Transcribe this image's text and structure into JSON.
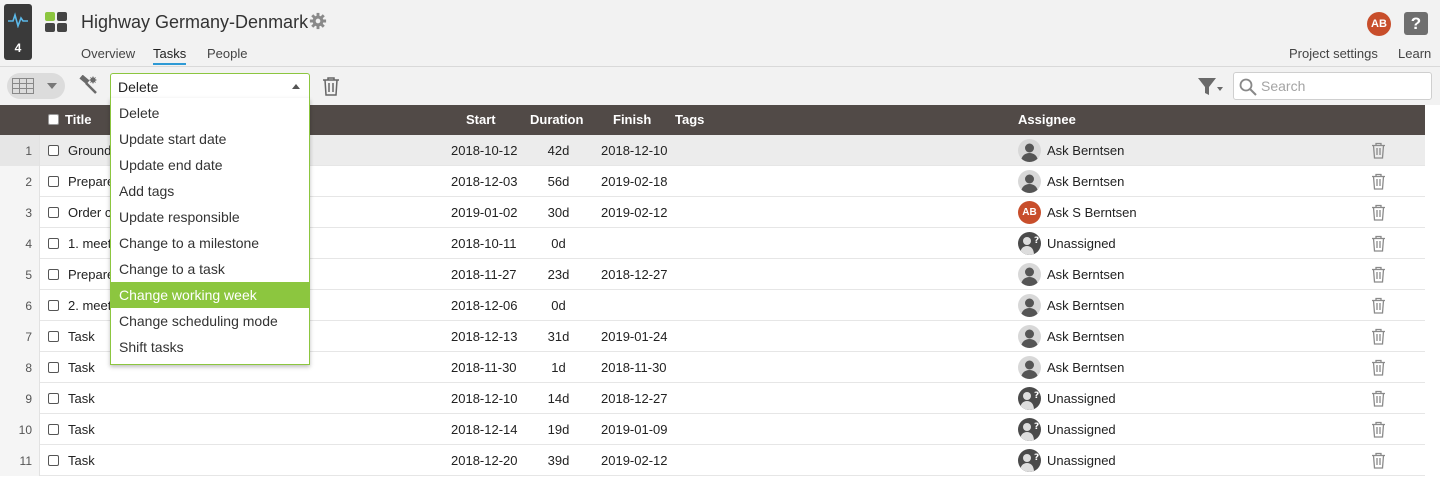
{
  "activity": {
    "count": "4"
  },
  "project": {
    "title": "Highway Germany-Denmark"
  },
  "nav": {
    "tabs": [
      "Overview",
      "Tasks",
      "People"
    ],
    "active": "Tasks"
  },
  "header_right": {
    "settings_link": "Project settings",
    "learn_link": "Learn",
    "user_initials": "AB",
    "help": "?"
  },
  "toolbar": {
    "bulk_action": {
      "selected": "Delete"
    },
    "search": {
      "placeholder": "Search",
      "value": ""
    }
  },
  "bulk_action_options": [
    "Delete",
    "Update start date",
    "Update end date",
    "Add tags",
    "Update responsible",
    "Change to a milestone",
    "Change to a task",
    "Change working week",
    "Change scheduling mode",
    "Shift tasks"
  ],
  "bulk_action_highlighted": "Change working week",
  "columns": {
    "title": "Title",
    "start": "Start",
    "duration": "Duration",
    "finish": "Finish",
    "tags": "Tags",
    "assignee": "Assignee"
  },
  "rows": [
    {
      "num": "1",
      "title": "Ground",
      "start": "2018-10-12",
      "duration": "42d",
      "finish": "2018-12-10",
      "assignee": "Ask Berntsen",
      "avatar": "person"
    },
    {
      "num": "2",
      "title": "Prepare",
      "start": "2018-12-03",
      "duration": "56d",
      "finish": "2019-02-18",
      "assignee": "Ask Berntsen",
      "avatar": "person"
    },
    {
      "num": "3",
      "title": "Order c",
      "start": "2019-01-02",
      "duration": "30d",
      "finish": "2019-02-12",
      "assignee": "Ask S Berntsen",
      "avatar": "AB"
    },
    {
      "num": "4",
      "title": "1. meet",
      "start": "2018-10-11",
      "duration": "0d",
      "finish": "",
      "assignee": "Unassigned",
      "avatar": "unassigned"
    },
    {
      "num": "5",
      "title": "Prepare",
      "start": "2018-11-27",
      "duration": "23d",
      "finish": "2018-12-27",
      "assignee": "Ask Berntsen",
      "avatar": "person"
    },
    {
      "num": "6",
      "title": "2. meet",
      "start": "2018-12-06",
      "duration": "0d",
      "finish": "",
      "assignee": "Ask Berntsen",
      "avatar": "person"
    },
    {
      "num": "7",
      "title": "Task",
      "start": "2018-12-13",
      "duration": "31d",
      "finish": "2019-01-24",
      "assignee": "Ask Berntsen",
      "avatar": "person"
    },
    {
      "num": "8",
      "title": "Task",
      "start": "2018-11-30",
      "duration": "1d",
      "finish": "2018-11-30",
      "assignee": "Ask Berntsen",
      "avatar": "person"
    },
    {
      "num": "9",
      "title": "Task",
      "start": "2018-12-10",
      "duration": "14d",
      "finish": "2018-12-27",
      "assignee": "Unassigned",
      "avatar": "unassigned"
    },
    {
      "num": "10",
      "title": "Task",
      "start": "2018-12-14",
      "duration": "19d",
      "finish": "2019-01-09",
      "assignee": "Unassigned",
      "avatar": "unassigned"
    },
    {
      "num": "11",
      "title": "Task",
      "start": "2018-12-20",
      "duration": "39d",
      "finish": "2019-02-12",
      "assignee": "Unassigned",
      "avatar": "unassigned"
    }
  ],
  "selected_row": "1",
  "colors": {
    "accent_green": "#8cc63f",
    "header_dark": "#514a47",
    "avatar_orange": "#c84e2b",
    "tab_underline": "#2e9ad5"
  }
}
